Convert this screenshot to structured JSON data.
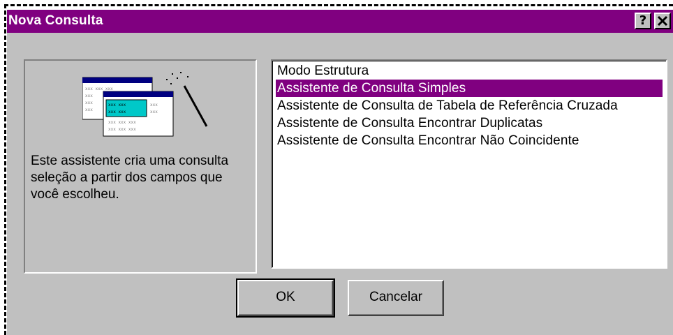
{
  "window": {
    "title": "Nova Consulta",
    "help_label": "?",
    "close_label": "✕"
  },
  "info": {
    "description": "Este assistente cria uma consulta seleção a partir dos campos que você escolheu.",
    "illustration_icon": "query-wizard-icon"
  },
  "options": [
    {
      "label": "Modo Estrutura",
      "selected": false
    },
    {
      "label": "Assistente de Consulta Simples",
      "selected": true
    },
    {
      "label": "Assistente de Consulta de Tabela de Referência Cruzada",
      "selected": false
    },
    {
      "label": "Assistente de Consulta Encontrar Duplicatas",
      "selected": false
    },
    {
      "label": "Assistente de Consulta Encontrar Não Coincidente",
      "selected": false
    }
  ],
  "buttons": {
    "ok": "OK",
    "cancel": "Cancelar"
  },
  "colors": {
    "titlebar": "#800080",
    "selection": "#800080",
    "dialog_face": "#c0c0c0"
  }
}
